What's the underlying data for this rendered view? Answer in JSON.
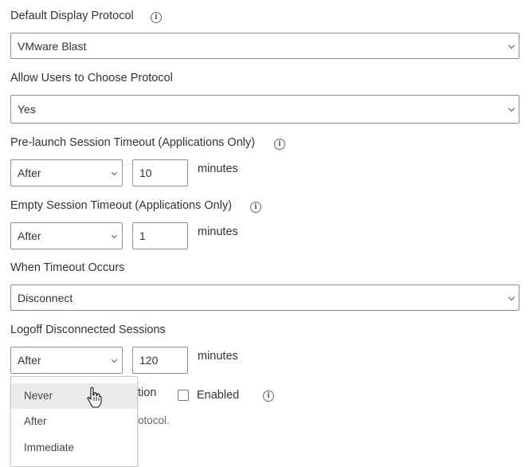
{
  "display_protocol": {
    "label": "Default Display Protocol",
    "value": "VMware Blast"
  },
  "choose_protocol": {
    "label": "Allow Users to Choose Protocol",
    "value": "Yes"
  },
  "prelaunch": {
    "label": "Pre-launch Session Timeout (Applications Only)",
    "mode": "After",
    "value": "10",
    "unit": "minutes"
  },
  "empty_session": {
    "label": "Empty Session Timeout (Applications Only)",
    "mode": "After",
    "value": "1",
    "unit": "minutes"
  },
  "timeout_action": {
    "label": "When Timeout Occurs",
    "value": "Disconnect"
  },
  "logoff": {
    "label": "Logoff Disconnected Sessions",
    "mode": "After",
    "value": "120",
    "unit": "minutes"
  },
  "dropdown": {
    "options": [
      "Never",
      "After",
      "Immediate"
    ],
    "highlighted": "Never"
  },
  "partial": {
    "label_fragment": "tion",
    "checkbox_label": "Enabled",
    "note_fragment": "otocol."
  },
  "icons": {
    "info": "info-icon",
    "chevron": "chevron-down-icon",
    "cursor": "hand-pointer-icon"
  }
}
